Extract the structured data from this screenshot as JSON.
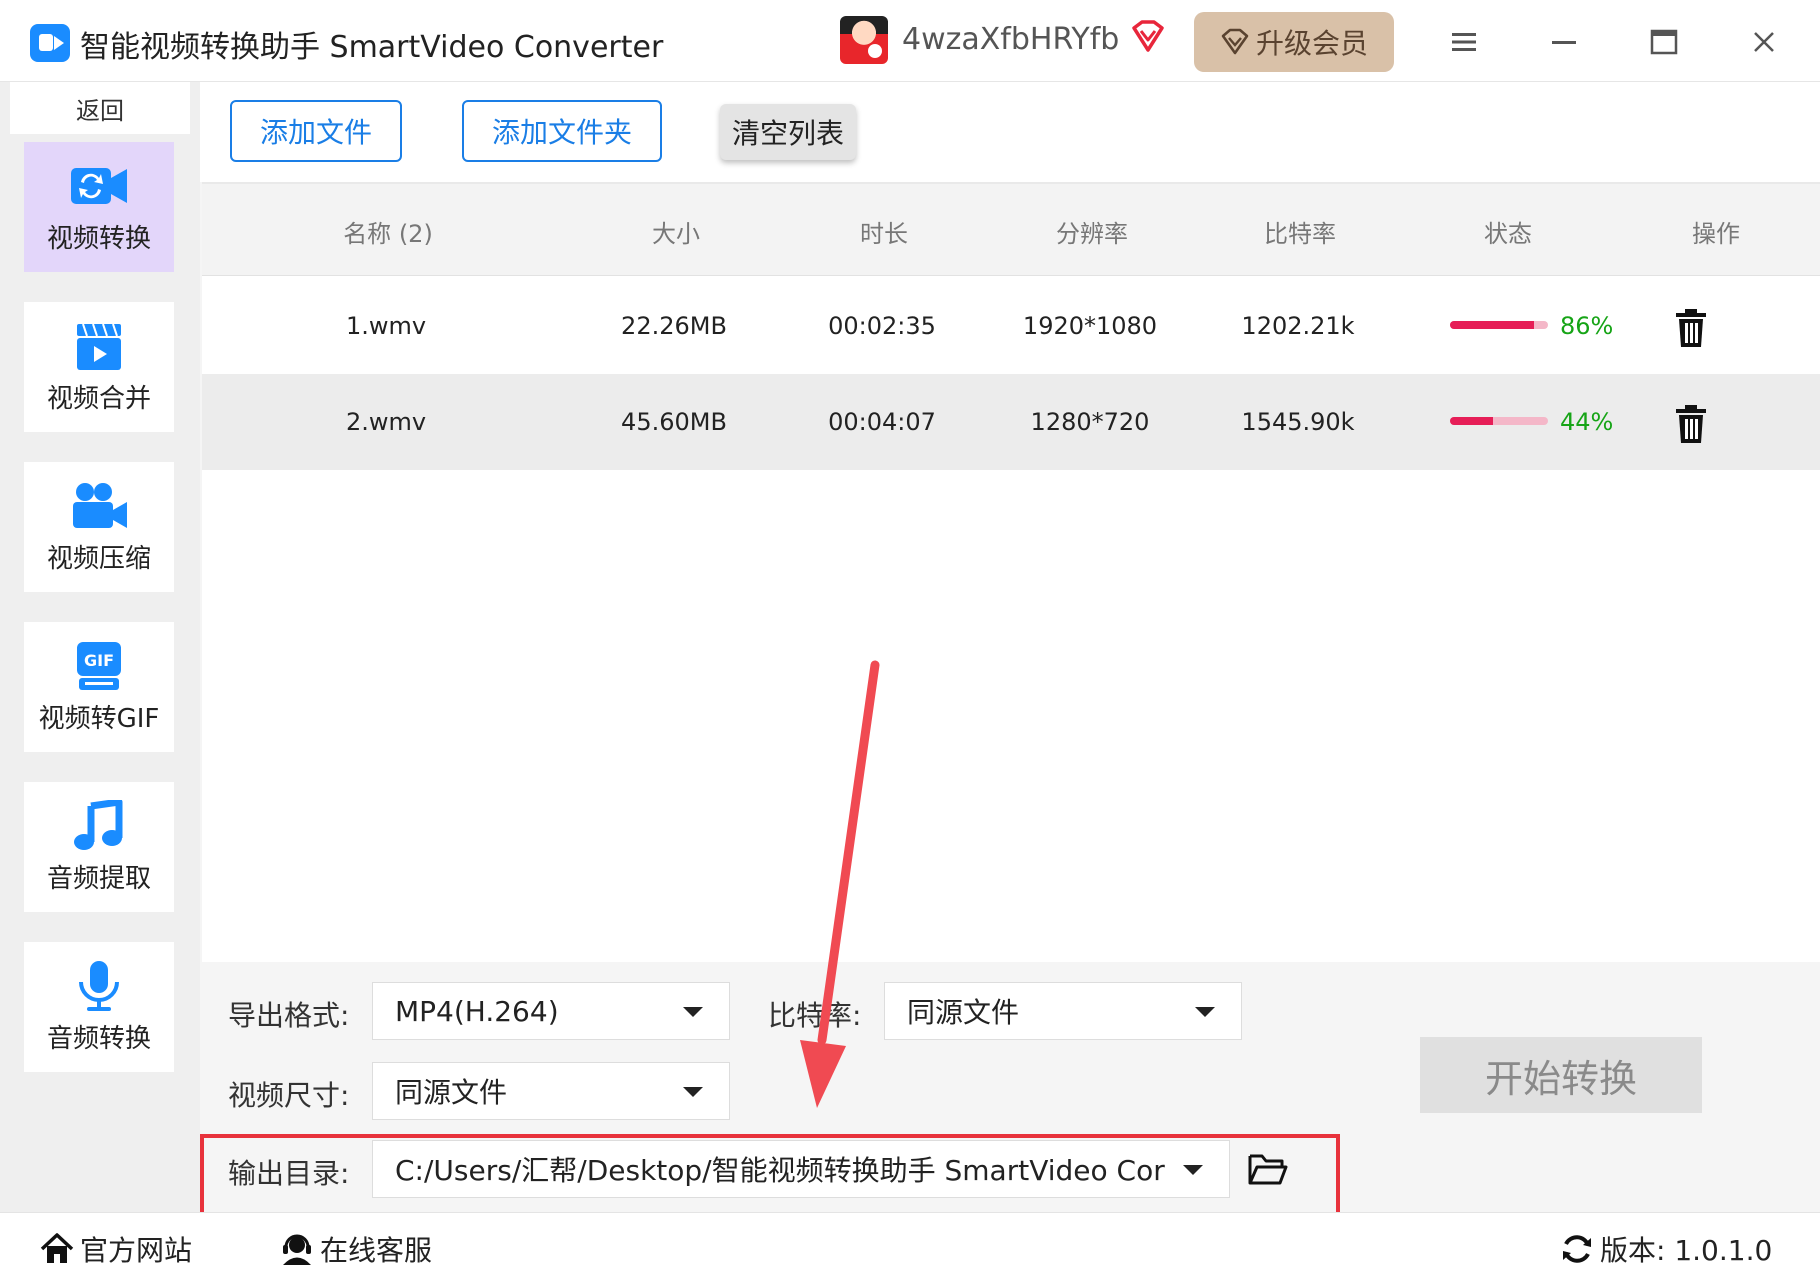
{
  "titlebar": {
    "title": "智能视频转换助手 SmartVideo Converter",
    "username": "4wzaXfbHRYfb",
    "upgrade_label": "升级会员"
  },
  "sidebar": {
    "back_label": "返回",
    "items": [
      {
        "label": "视频转换",
        "icon": "video-convert-icon",
        "active": true
      },
      {
        "label": "视频合并",
        "icon": "video-merge-icon",
        "active": false
      },
      {
        "label": "视频压缩",
        "icon": "video-compress-icon",
        "active": false
      },
      {
        "label": "视频转GIF",
        "icon": "gif-icon",
        "active": false
      },
      {
        "label": "音频提取",
        "icon": "music-icon",
        "active": false
      },
      {
        "label": "音频转换",
        "icon": "microphone-icon",
        "active": false
      }
    ]
  },
  "toolbar": {
    "add_file": "添加文件",
    "add_folder": "添加文件夹",
    "clear_list": "清空列表"
  },
  "table": {
    "headers": {
      "name": "名称 (2)",
      "size": "大小",
      "duration": "时长",
      "resolution": "分辨率",
      "bitrate": "比特率",
      "status": "状态",
      "action": "操作"
    },
    "rows": [
      {
        "name": "1.wmv",
        "size": "22.26MB",
        "duration": "00:02:35",
        "resolution": "1920*1080",
        "bitrate": "1202.21k",
        "progress": 86,
        "progress_label": "86%"
      },
      {
        "name": "2.wmv",
        "size": "45.60MB",
        "duration": "00:04:07",
        "resolution": "1280*720",
        "bitrate": "1545.90k",
        "progress": 44,
        "progress_label": "44%"
      }
    ]
  },
  "settings": {
    "format_label": "导出格式:",
    "format_value": "MP4(H.264)",
    "bitrate_label": "比特率:",
    "bitrate_value": "同源文件",
    "size_label": "视频尺寸:",
    "size_value": "同源文件",
    "output_label": "输出目录:",
    "output_value": "C:/Users/汇帮/Desktop/智能视频转换助手 SmartVideo Cor",
    "start_label": "开始转换"
  },
  "footer": {
    "website": "官方网站",
    "support": "在线客服",
    "version": "版本:  1.0.1.0"
  },
  "colors": {
    "accent": "#1a7ee6",
    "progress": "#e61e57",
    "progress_track": "#f4b7c8",
    "percent_text": "#16a416",
    "highlight": "#e8323c",
    "upgrade_bg": "#d9c1a8",
    "active_nav": "#e3d6fa"
  }
}
